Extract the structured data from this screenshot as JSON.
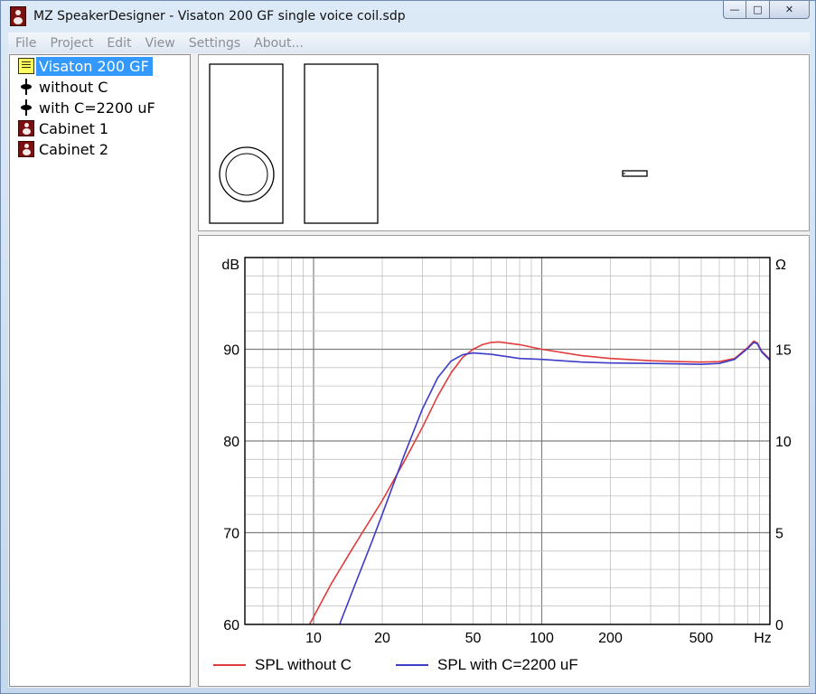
{
  "window": {
    "title": "MZ SpeakerDesigner - Visaton 200 GF single voice coil.sdp",
    "controls": {
      "minimize": "—",
      "maximize": "□",
      "close": "✕"
    }
  },
  "menu": [
    "File",
    "Project",
    "Edit",
    "View",
    "Settings",
    "About..."
  ],
  "tree": {
    "items": [
      {
        "label": "Visaton 200 GF",
        "icon": "driver-document-icon",
        "selected": true
      },
      {
        "label": "without C",
        "icon": "filter-node-icon"
      },
      {
        "label": "with C=2200 uF",
        "icon": "filter-node-icon"
      },
      {
        "label": "Cabinet 1",
        "icon": "cabinet-icon"
      },
      {
        "label": "Cabinet 2",
        "icon": "cabinet-icon"
      }
    ]
  },
  "colors": {
    "selection": "#3399ff",
    "series_red": "#e03c3c",
    "series_blue": "#3c3cc8",
    "grid": "#c0c0c0",
    "grid_major": "#808080"
  },
  "chart_data": {
    "type": "line",
    "x_scale": "log",
    "xlim": [
      5,
      1000
    ],
    "ylim": [
      60,
      100
    ],
    "y2lim": [
      0,
      20
    ],
    "ylabel": "dB",
    "y2label": "Ω",
    "xunit": "Hz",
    "x_ticks": [
      10,
      20,
      50,
      100,
      200,
      500
    ],
    "y_ticks": [
      60,
      70,
      80,
      90
    ],
    "y2_ticks": [
      0,
      5,
      10,
      15
    ],
    "series": [
      {
        "name": "SPL without C",
        "color": "#e03c3c",
        "points": [
          [
            9.6,
            60
          ],
          [
            12,
            64.5
          ],
          [
            15,
            68.5
          ],
          [
            20,
            73.5
          ],
          [
            25,
            77.8
          ],
          [
            30,
            81.5
          ],
          [
            35,
            84.9
          ],
          [
            40,
            87.4
          ],
          [
            45,
            89.1
          ],
          [
            50,
            90.0
          ],
          [
            55,
            90.5
          ],
          [
            60,
            90.75
          ],
          [
            65,
            90.8
          ],
          [
            80,
            90.5
          ],
          [
            100,
            90.0
          ],
          [
            150,
            89.3
          ],
          [
            200,
            89.0
          ],
          [
            300,
            88.75
          ],
          [
            400,
            88.65
          ],
          [
            500,
            88.6
          ],
          [
            600,
            88.65
          ],
          [
            700,
            89.0
          ],
          [
            800,
            90.2
          ],
          [
            850,
            90.9
          ],
          [
            880,
            90.7
          ],
          [
            920,
            89.8
          ],
          [
            1000,
            88.9
          ]
        ]
      },
      {
        "name": "SPL with C=2200 uF",
        "color": "#3c3cc8",
        "points": [
          [
            13,
            60
          ],
          [
            15,
            64
          ],
          [
            18,
            69
          ],
          [
            20,
            72
          ],
          [
            25,
            78.5
          ],
          [
            30,
            83.5
          ],
          [
            35,
            86.9
          ],
          [
            40,
            88.7
          ],
          [
            45,
            89.4
          ],
          [
            50,
            89.6
          ],
          [
            60,
            89.45
          ],
          [
            80,
            89.0
          ],
          [
            100,
            88.9
          ],
          [
            150,
            88.6
          ],
          [
            200,
            88.5
          ],
          [
            300,
            88.45
          ],
          [
            400,
            88.4
          ],
          [
            500,
            88.35
          ],
          [
            600,
            88.45
          ],
          [
            700,
            88.9
          ],
          [
            800,
            90.1
          ],
          [
            850,
            90.75
          ],
          [
            880,
            90.6
          ],
          [
            920,
            89.7
          ],
          [
            1000,
            88.8
          ]
        ]
      }
    ]
  }
}
